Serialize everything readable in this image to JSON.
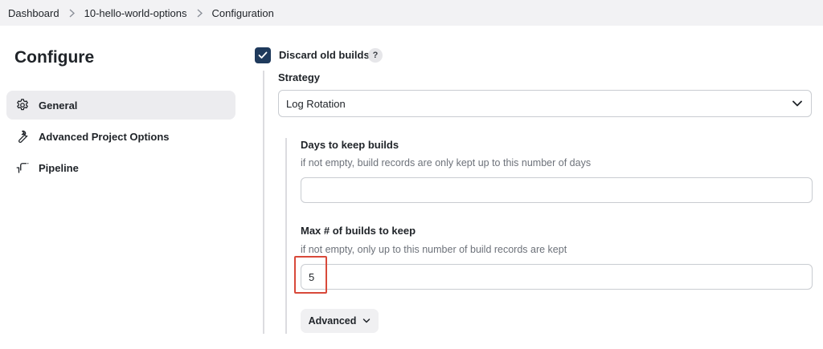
{
  "breadcrumb": {
    "items": [
      "Dashboard",
      "10-hello-world-options",
      "Configuration"
    ]
  },
  "sidebar": {
    "title": "Configure",
    "items": [
      {
        "label": "General",
        "icon": "gear-icon",
        "active": true
      },
      {
        "label": "Advanced Project Options",
        "icon": "wrench-icon",
        "active": false
      },
      {
        "label": "Pipeline",
        "icon": "pipeline-icon",
        "active": false
      }
    ]
  },
  "discard": {
    "label": "Discard old builds",
    "checked": true,
    "help": "?"
  },
  "strategy": {
    "label": "Strategy",
    "selected": "Log Rotation"
  },
  "days_to_keep": {
    "label": "Days to keep builds",
    "help": "if not empty, build records are only kept up to this number of days",
    "value": ""
  },
  "max_builds": {
    "label": "Max # of builds to keep",
    "help": "if not empty, only up to this number of build records are kept",
    "value": "5"
  },
  "advanced": {
    "label": "Advanced"
  },
  "colors": {
    "accent": "#1f3a5c",
    "highlight": "#d8493a",
    "breadcrumb_bg": "#f2f2f4"
  }
}
